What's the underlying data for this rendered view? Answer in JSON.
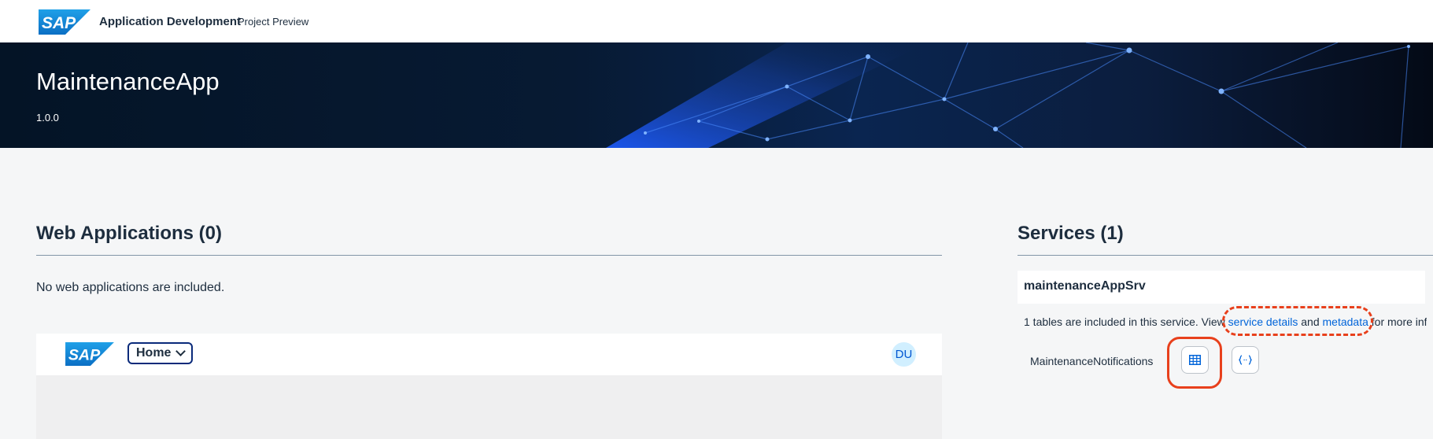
{
  "header": {
    "logo_text": "SAP",
    "title": "Application Development",
    "subtitle": "Project Preview"
  },
  "banner": {
    "app_name": "MaintenanceApp",
    "version": "1.0.0"
  },
  "web_applications": {
    "title": "Web Applications (0)",
    "empty_message": "No web applications are included.",
    "preview": {
      "logo_text": "SAP",
      "home_label": "Home",
      "avatar_initials": "DU"
    }
  },
  "services": {
    "title": "Services (1)",
    "items": [
      {
        "name": "maintenanceAppSrv",
        "description_prefix": "1 tables are included in this service. View ",
        "service_details_link": "service details",
        "and_text": " and ",
        "metadata_link": "metadata",
        "description_suffix": " for more information.",
        "entities": [
          {
            "name": "MaintenanceNotifications",
            "actions": [
              "table-icon",
              "code-braces-icon"
            ]
          }
        ]
      }
    ]
  },
  "colors": {
    "banner": "#071a33",
    "link": "#0064d9",
    "highlight": "#e8401c",
    "avatar_bg": "#d1efff"
  }
}
